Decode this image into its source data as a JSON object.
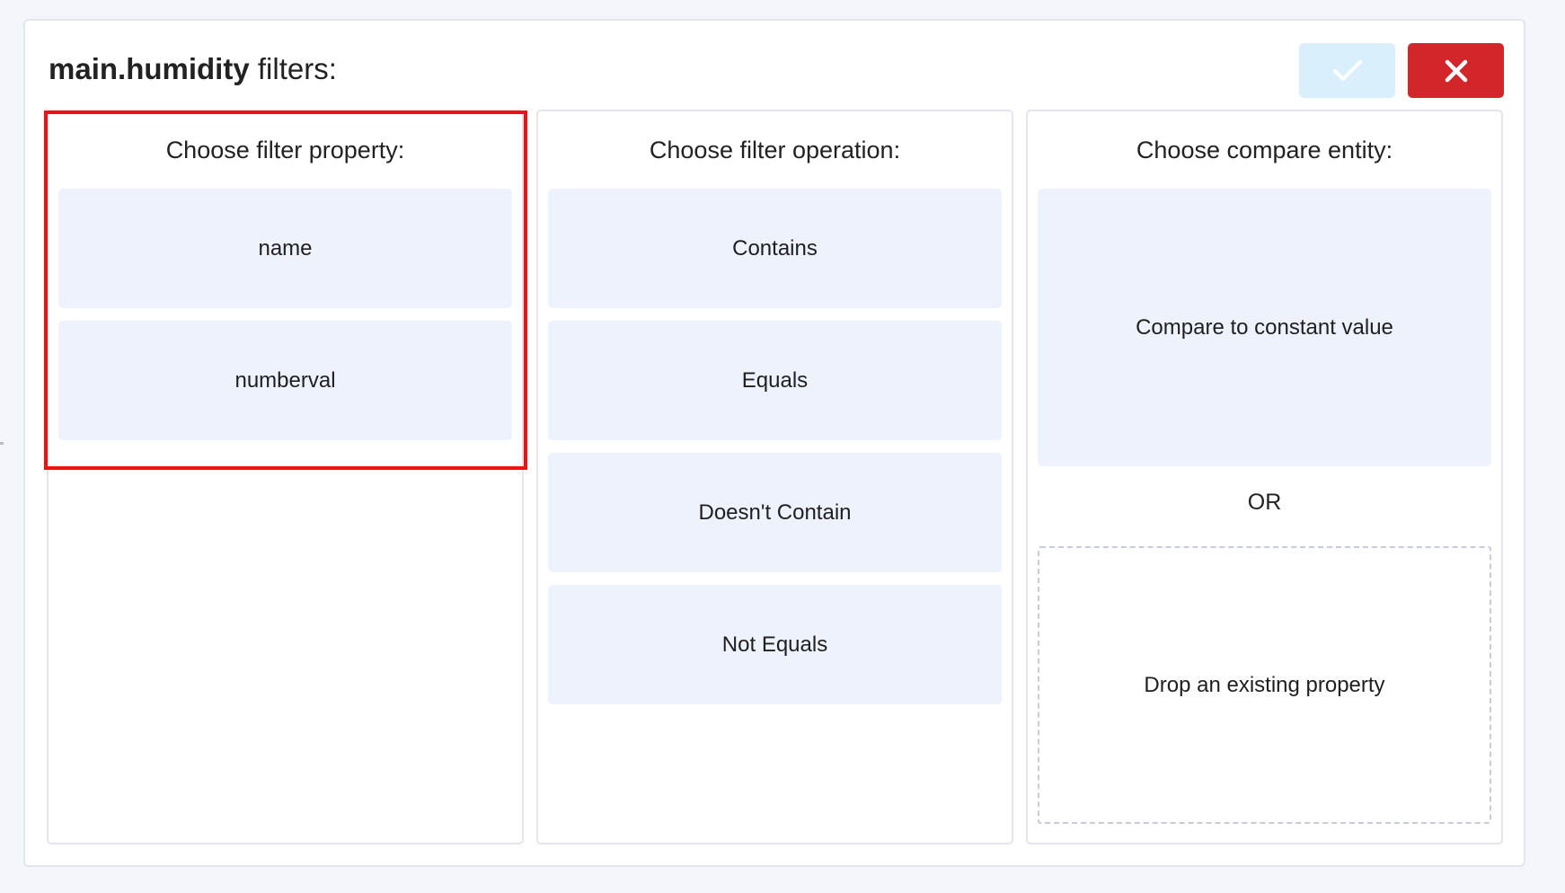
{
  "dialog": {
    "title_entity": "main.humidity",
    "title_suffix": " filters:"
  },
  "buttons": {
    "confirm_icon": "check-icon",
    "cancel_icon": "close-icon",
    "confirm_color": "#d9effb",
    "cancel_color": "#d3262b"
  },
  "property_panel": {
    "heading": "Choose filter property:",
    "options": [
      {
        "label": "name"
      },
      {
        "label": "numberval"
      }
    ]
  },
  "operation_panel": {
    "heading": "Choose filter operation:",
    "options": [
      {
        "label": "Contains"
      },
      {
        "label": "Equals"
      },
      {
        "label": "Doesn't Contain"
      },
      {
        "label": "Not Equals"
      }
    ]
  },
  "compare_panel": {
    "heading": "Choose compare entity:",
    "constant_label": "Compare to constant value",
    "or_label": "OR",
    "drop_label": "Drop an existing property"
  },
  "colors": {
    "option_bg": "#edf2fd",
    "highlight": "#ee1111"
  }
}
